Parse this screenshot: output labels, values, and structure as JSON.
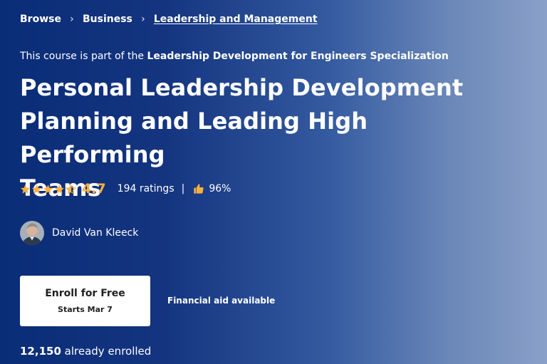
{
  "breadcrumb": {
    "items": [
      "Browse",
      "Business",
      "Leadership and Management"
    ]
  },
  "specialization": {
    "prefix": "This course is part of the",
    "name": "Leadership Development for Engineers Specialization"
  },
  "course": {
    "title_lines": [
      "Personal Leadership Development",
      "Planning and Leading High Performing",
      "Teams"
    ]
  },
  "rating": {
    "value": "4.7",
    "stars": 4.7,
    "count_label": "194 ratings",
    "divider": "|",
    "approval": "96%",
    "star_color": "#f5b042"
  },
  "instructor": {
    "name": "David Van Kleeck",
    "avatar_icon": "instructor-avatar"
  },
  "enroll": {
    "label": "Enroll for Free",
    "start": "Starts Mar 7"
  },
  "financial_aid": "Financial aid available",
  "enrollment": {
    "count": "12,150",
    "suffix": "already enrolled"
  },
  "colors": {
    "gradient_start": "#0a2d78",
    "gradient_end": "#8aa0c8",
    "accent_star": "#f5b042",
    "button_bg": "#ffffff"
  }
}
